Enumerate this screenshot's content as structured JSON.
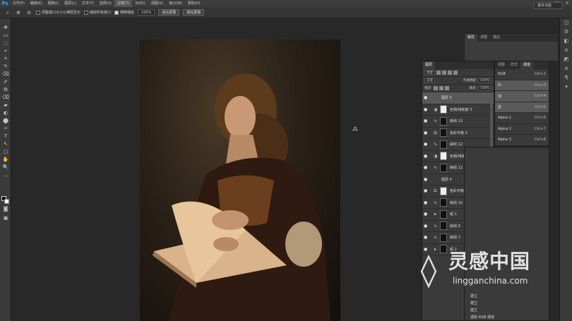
{
  "app": {
    "logo": "Ps"
  },
  "menubar": {
    "items": [
      "文件(F)",
      "编辑(E)",
      "图像(I)",
      "图层(L)",
      "文字(Y)",
      "选择(S)",
      "滤镜(T)",
      "3D(D)",
      "视图(V)",
      "窗口(W)",
      "帮助(H)"
    ],
    "window_controls": [
      "—",
      "□",
      "✕"
    ]
  },
  "options_bar": {
    "tool_icon": "zoom-icon",
    "resize_windows_label": "调整窗口大小以满屏显示",
    "zoom_all_label": "缩放所有窗口",
    "scrubby_zoom_label": "细微缩放",
    "zoom_value": "100%",
    "fit_screen_label": "适合屏幕",
    "fill_screen_label": "填充屏幕",
    "workspace": "基本功能"
  },
  "tools": [
    "✥",
    "▭",
    "◌",
    "⌖",
    "⌗",
    "✎",
    "⌫",
    "✐",
    "⧉",
    "⌫",
    "▰",
    "◐",
    "⬤",
    "✑",
    "T",
    "↖",
    "▢",
    "✋",
    "🔍",
    "…"
  ],
  "right_strip_icons": [
    "◫",
    "⚙",
    "◧",
    "≡",
    "◩",
    "A",
    "¶",
    "✦"
  ],
  "panel_back": {
    "tabs": [
      "属性",
      "调整",
      "描边"
    ]
  },
  "layers_panel": {
    "tabs": [
      "图层"
    ],
    "filter_label": "类型",
    "blend_mode": "正常",
    "opacity_label": "不透明度:",
    "opacity_value": "100%",
    "lock_label": "锁定:",
    "fill_label": "填充:",
    "fill_value": "100%",
    "layers": [
      {
        "name": "图层 5",
        "thumb": "photo",
        "selected": true,
        "adj": ""
      },
      {
        "name": "色相/饱和度 3",
        "thumb": "white",
        "selected": false,
        "adj": "◑"
      },
      {
        "name": "曲线 13",
        "thumb": "black",
        "selected": false,
        "adj": "∿"
      },
      {
        "name": "色彩平衡 3",
        "thumb": "black",
        "selected": false,
        "adj": "⚖"
      },
      {
        "name": "曲线 12",
        "thumb": "black",
        "selected": false,
        "adj": "∿"
      },
      {
        "name": "色相/饱和度 2",
        "thumb": "white",
        "selected": false,
        "adj": "◑"
      },
      {
        "name": "曲线 11",
        "thumb": "black",
        "selected": false,
        "adj": "∿"
      },
      {
        "name": "图层 4",
        "thumb": "photo",
        "selected": false,
        "adj": ""
      },
      {
        "name": "色彩平衡 2",
        "thumb": "white",
        "selected": false,
        "adj": "⚖"
      },
      {
        "name": "曲线 10",
        "thumb": "black",
        "selected": false,
        "adj": "∿"
      },
      {
        "name": "组 1",
        "thumb": "black",
        "selected": false,
        "adj": "▸"
      },
      {
        "name": "曲线 9",
        "thumb": "black",
        "selected": false,
        "adj": "∿"
      },
      {
        "name": "曲线 7",
        "thumb": "black",
        "selected": false,
        "adj": "∿"
      },
      {
        "name": "组 2",
        "thumb": "black",
        "selected": false,
        "adj": "▸"
      }
    ]
  },
  "channels_panel": {
    "tabs": [
      "调整",
      "样式",
      "通道"
    ],
    "channels": [
      {
        "name": "RGB",
        "key": "Ctrl+2",
        "selected": false
      },
      {
        "name": "红",
        "key": "Ctrl+3",
        "selected": true
      },
      {
        "name": "绿",
        "key": "Ctrl+4",
        "selected": true
      },
      {
        "name": "蓝",
        "key": "Ctrl+5",
        "selected": true
      },
      {
        "name": "Alpha 1",
        "key": "Ctrl+6",
        "selected": false
      },
      {
        "name": "Alpha 2",
        "key": "Ctrl+7",
        "selected": false
      },
      {
        "name": "Alpha 3",
        "key": "Ctrl+8",
        "selected": false
      }
    ]
  },
  "history_panel": {
    "items": [
      "建立",
      "建立",
      "建立",
      "选取 RGB 通道"
    ]
  },
  "watermark": {
    "cn": "灵感中国",
    "url": "lingganchina.com"
  }
}
